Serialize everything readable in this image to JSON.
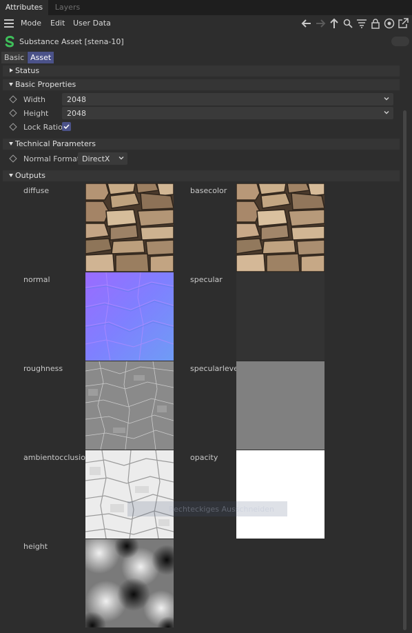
{
  "tabs": {
    "attributes": "Attributes",
    "layers": "Layers"
  },
  "menu": {
    "mode": "Mode",
    "edit": "Edit",
    "user_data": "User Data"
  },
  "object": {
    "title": "Substance Asset [stena-10]"
  },
  "subtabs": {
    "basic": "Basic",
    "asset": "Asset"
  },
  "sections": {
    "status": "Status",
    "basic_properties": "Basic Properties",
    "technical_parameters": "Technical Parameters",
    "outputs": "Outputs"
  },
  "props": {
    "width_label": "Width",
    "width_value": "2048",
    "height_label": "Height",
    "height_value": "2048",
    "lock_ratio_label": "Lock Ratio",
    "lock_ratio_checked": true,
    "normal_format_label": "Normal Format",
    "normal_format_value": "DirectX"
  },
  "outputs": {
    "diffuse": "diffuse",
    "basecolor": "basecolor",
    "normal": "normal",
    "specular": "specular",
    "roughness": "roughness",
    "specularlevel": "specularlevel",
    "ambientocclusion": "ambientocclusion",
    "opacity": "opacity",
    "height": "height"
  },
  "tooltip": "Rechteckiges Ausschneiden",
  "colors": {
    "accent": "#4b5289",
    "specular_swatch": "#333333",
    "specularlevel_swatch": "#808080",
    "opacity_swatch": "#ffffff"
  }
}
